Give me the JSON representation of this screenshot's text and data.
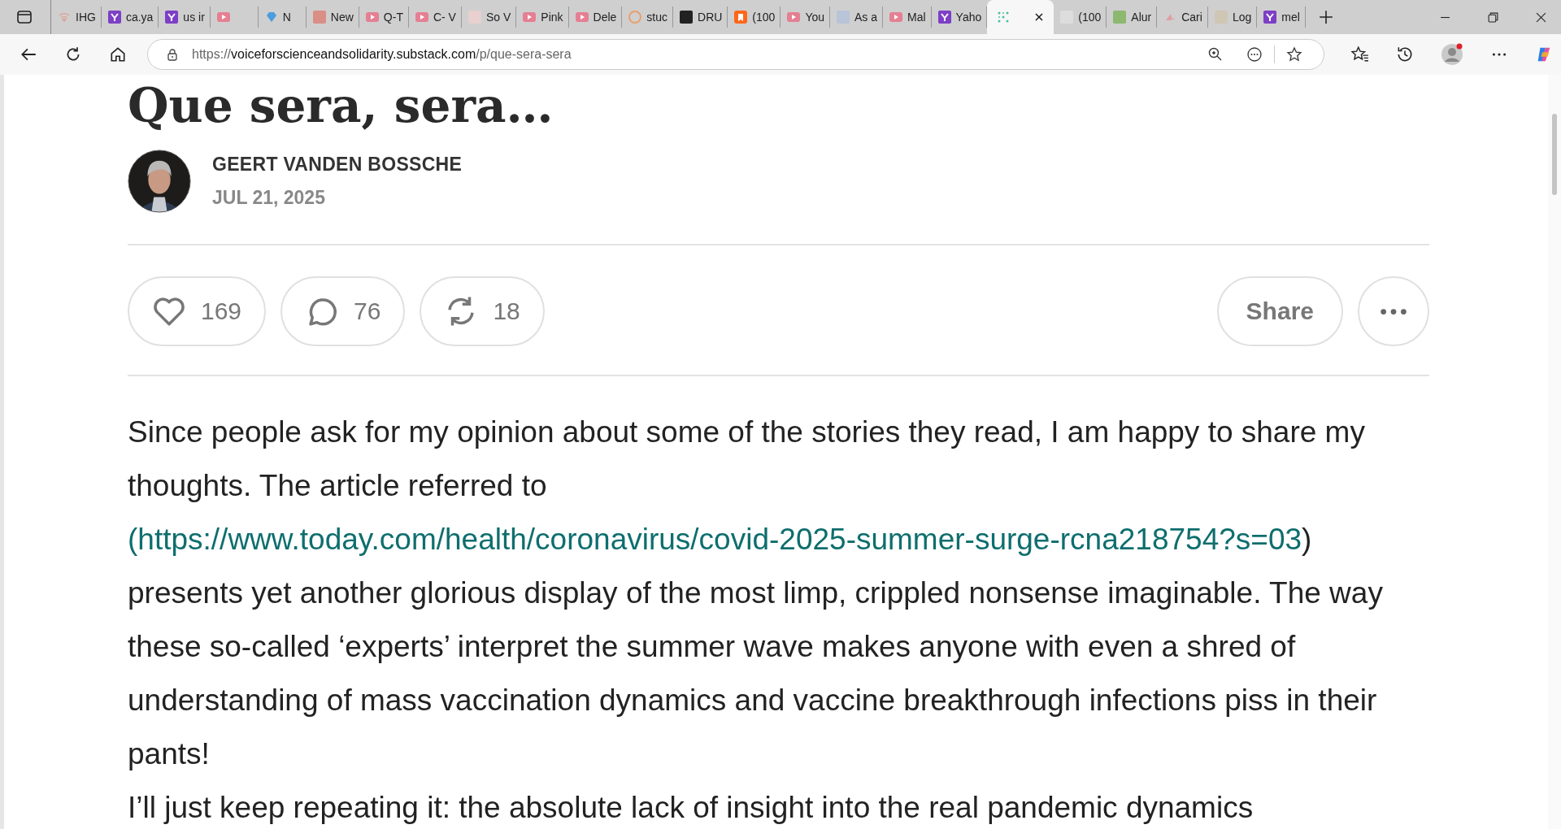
{
  "tabs": [
    {
      "kind": "wifi",
      "label": "IHG",
      "selected": false
    },
    {
      "kind": "yahoo",
      "label": "ca.ya",
      "selected": false
    },
    {
      "kind": "yahoo",
      "label": "us ir",
      "selected": false
    },
    {
      "kind": "video",
      "selected": false
    },
    {
      "kind": "gem",
      "label": "N",
      "selected": false
    },
    {
      "kind": "square",
      "color": "#d98f86",
      "label": "New",
      "selected": false
    },
    {
      "kind": "video",
      "label": "Q-T",
      "selected": false
    },
    {
      "kind": "video",
      "label": "C- V",
      "selected": false
    },
    {
      "kind": "square",
      "color": "#e8d0d0",
      "label": "So V",
      "selected": false
    },
    {
      "kind": "video",
      "label": "Pink",
      "selected": false
    },
    {
      "kind": "video",
      "label": "Dele",
      "selected": false
    },
    {
      "kind": "circle",
      "color": "#e8a070",
      "label": "stuc",
      "selected": false
    },
    {
      "kind": "square",
      "color": "#222222",
      "label": "DRU",
      "selected": false
    },
    {
      "kind": "bookmark",
      "label": "(100",
      "selected": false
    },
    {
      "kind": "video",
      "label": "You",
      "selected": false
    },
    {
      "kind": "square",
      "color": "#b8c4d8",
      "label": "As a",
      "selected": false
    },
    {
      "kind": "video",
      "label": "Mal",
      "selected": false
    },
    {
      "kind": "yahoo",
      "label": "Yaho",
      "selected": false
    },
    {
      "kind": "dots",
      "selected": true
    },
    {
      "kind": "square",
      "color": "#dddddd",
      "label": "(100",
      "selected": false
    },
    {
      "kind": "square",
      "color": "#8cb870",
      "label": "Alur",
      "selected": false
    },
    {
      "kind": "bird",
      "label": "Cari",
      "selected": false
    },
    {
      "kind": "square",
      "color": "#cfc6b4",
      "label": "Log",
      "selected": false
    },
    {
      "kind": "yahoo",
      "label": "mel",
      "selected": false
    }
  ],
  "address": {
    "scheme": "https://",
    "host": "voiceforscienceandsolidarity.substack.com",
    "path": "/p/que-sera-sera"
  },
  "post": {
    "title": "Que sera, sera…",
    "author": "GEERT VANDEN BOSSCHE",
    "date": "JUL 21, 2025",
    "actions": [
      {
        "kind": "like",
        "count": "169"
      },
      {
        "kind": "comment",
        "count": "76"
      },
      {
        "kind": "restack",
        "count": "18"
      }
    ],
    "share": "Share",
    "paragraphs": [
      {
        "before": "Since people ask for my opinion about some of the stories they read, I am happy to share my thoughts. The article referred to ",
        "link": "(https://www.today.com/health/coronavirus/covid-2025-summer-surge-rcna218754?s=03",
        "after": ") presents yet another glorious display of the most limp, crippled nonsense imaginable. The way these so-called ‘experts’ interpret the summer wave makes anyone with even a shred of understanding of mass vaccination dynamics and vaccine breakthrough infections piss in their pants!"
      },
      {
        "before": "I’ll just keep repeating it: the absolute lack of insight into the real pandemic dynamics"
      }
    ]
  }
}
